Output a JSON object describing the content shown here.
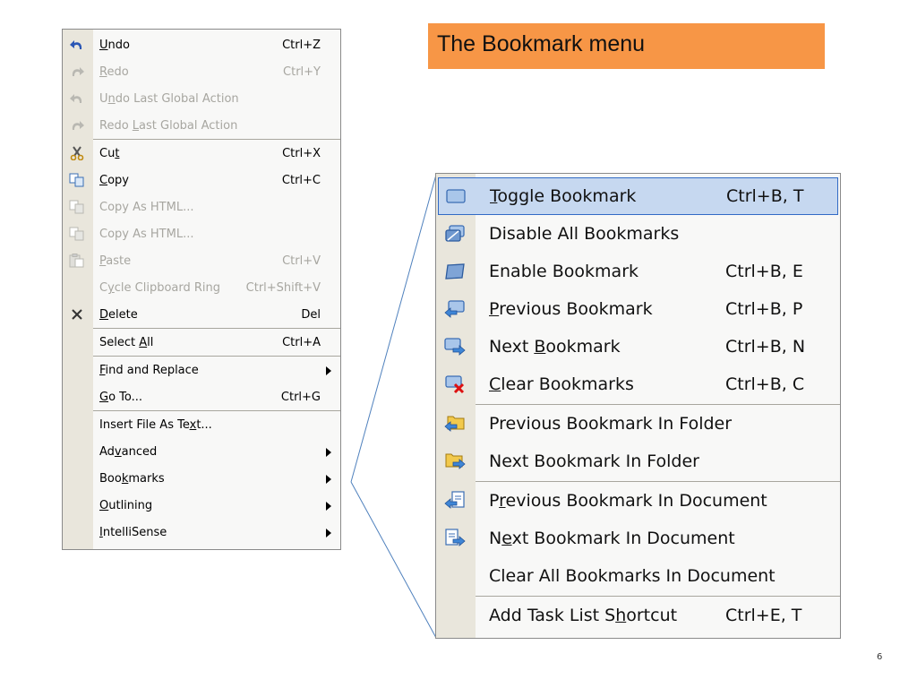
{
  "title": "The Bookmark menu",
  "page_number": "6",
  "colors": {
    "title_bg": "#f79646",
    "highlight_bg": "#c6d8f0",
    "highlight_border": "#316ac5"
  },
  "edit_menu": {
    "items": [
      {
        "label_html": "<u>U</u>ndo",
        "shortcut": "Ctrl+Z",
        "icon": "undo-icon",
        "disabled": false
      },
      {
        "label_html": "<u>R</u>edo",
        "shortcut": "Ctrl+Y",
        "icon": "redo-icon",
        "disabled": true
      },
      {
        "label_html": "U<u>n</u>do Last Global Action",
        "shortcut": "",
        "icon": "undo-icon",
        "disabled": true
      },
      {
        "label_html": "Redo <u>L</u>ast Global Action",
        "shortcut": "",
        "icon": "redo-icon",
        "disabled": true
      },
      {
        "label_html": "Cu<u>t</u>",
        "shortcut": "Ctrl+X",
        "icon": "scissors-icon",
        "disabled": false
      },
      {
        "label_html": "<u>C</u>opy",
        "shortcut": "Ctrl+C",
        "icon": "copy-icon",
        "disabled": false
      },
      {
        "label_html": "Copy As HTML...",
        "shortcut": "",
        "icon": "copy-icon",
        "disabled": true
      },
      {
        "label_html": "Copy As HTML...",
        "shortcut": "",
        "icon": "copy-icon",
        "disabled": true
      },
      {
        "label_html": "<u>P</u>aste",
        "shortcut": "Ctrl+V",
        "icon": "paste-icon",
        "disabled": true
      },
      {
        "label_html": "C<u>y</u>cle Clipboard Ring",
        "shortcut": "Ctrl+Shift+V",
        "icon": "",
        "disabled": true
      },
      {
        "label_html": "<u>D</u>elete",
        "shortcut": "Del",
        "icon": "delete-icon",
        "disabled": false
      },
      {
        "label_html": "Select <u>A</u>ll",
        "shortcut": "Ctrl+A",
        "icon": "",
        "disabled": false
      },
      {
        "label_html": "<u>F</u>ind and Replace",
        "shortcut": "",
        "icon": "",
        "disabled": false,
        "submenu": true
      },
      {
        "label_html": "<u>G</u>o To...",
        "shortcut": "Ctrl+G",
        "icon": "",
        "disabled": false
      },
      {
        "label_html": "Insert File As Te<u>x</u>t...",
        "shortcut": "",
        "icon": "",
        "disabled": false
      },
      {
        "label_html": "Ad<u>v</u>anced",
        "shortcut": "",
        "icon": "",
        "disabled": false,
        "submenu": true
      },
      {
        "label_html": "Boo<u>k</u>marks",
        "shortcut": "",
        "icon": "",
        "disabled": false,
        "submenu": true
      },
      {
        "label_html": "<u>O</u>utlining",
        "shortcut": "",
        "icon": "",
        "disabled": false,
        "submenu": true
      },
      {
        "label_html": "<u>I</u>ntelliSense",
        "shortcut": "",
        "icon": "",
        "disabled": false,
        "submenu": true
      }
    ],
    "separators_after": [
      3,
      10,
      11,
      13
    ]
  },
  "bookmark_menu": {
    "items": [
      {
        "label_html": "<u>T</u>oggle Bookmark",
        "shortcut": "Ctrl+B, T",
        "icon": "toggle-bookmark-icon",
        "highlighted": true
      },
      {
        "label_html": "Disable All Bookmarks",
        "shortcut": "",
        "icon": "disable-bookmarks-icon"
      },
      {
        "label_html": "Enable Bookmark",
        "shortcut": "Ctrl+B, E",
        "icon": "enable-bookmark-icon"
      },
      {
        "label_html": "<u>P</u>revious Bookmark",
        "shortcut": "Ctrl+B, P",
        "icon": "previous-bookmark-icon"
      },
      {
        "label_html": "Next <u>B</u>ookmark",
        "shortcut": "Ctrl+B, N",
        "icon": "next-bookmark-icon"
      },
      {
        "label_html": "<u>C</u>lear Bookmarks",
        "shortcut": "Ctrl+B, C",
        "icon": "clear-bookmarks-icon"
      },
      {
        "label_html": "Previous Bookmark In Folder",
        "shortcut": "",
        "icon": "previous-folder-bookmark-icon"
      },
      {
        "label_html": "Next Bookmark In Folder",
        "shortcut": "",
        "icon": "next-folder-bookmark-icon"
      },
      {
        "label_html": "P<u>r</u>evious Bookmark In Document",
        "shortcut": "",
        "icon": "previous-document-bookmark-icon"
      },
      {
        "label_html": "N<u>e</u>xt Bookmark In Document",
        "shortcut": "",
        "icon": "next-document-bookmark-icon"
      },
      {
        "label_html": "Clear All Bookmarks In Document",
        "shortcut": "",
        "icon": ""
      },
      {
        "label_html": "Add Task List S<u>h</u>ortcut",
        "shortcut": "Ctrl+E, T",
        "icon": ""
      }
    ],
    "separators_after": [
      5,
      7,
      10
    ]
  }
}
